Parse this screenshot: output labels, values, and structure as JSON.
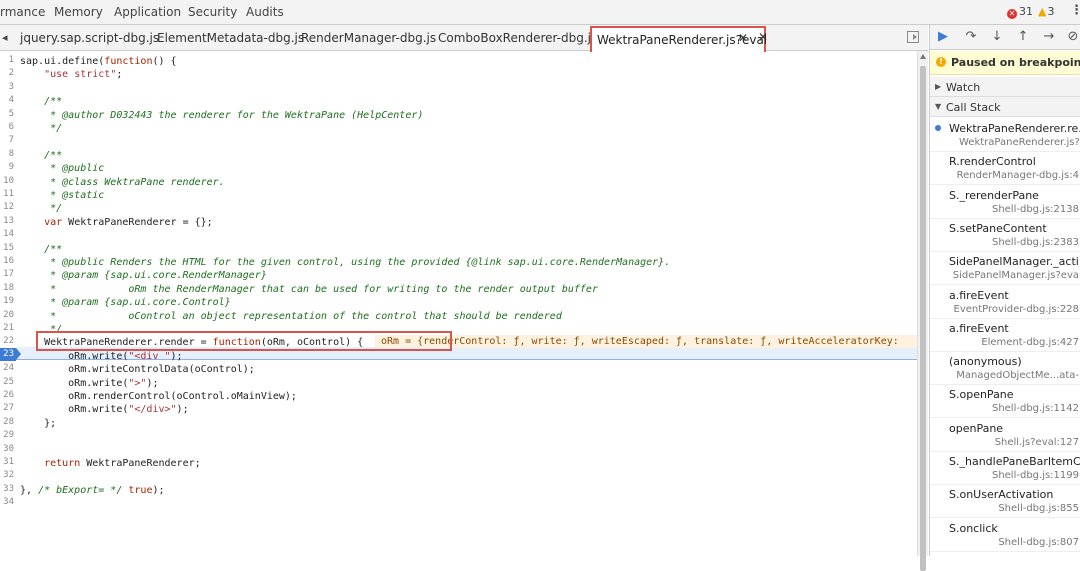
{
  "top_tabs": [
    "rmance",
    "Memory",
    "Application",
    "Security",
    "Audits"
  ],
  "errors": {
    "error_count": "31",
    "warning_count": "3"
  },
  "file_tabs": [
    "jquery.sap.script-dbg.js",
    "ElementMetadata-dbg.js",
    "RenderManager-dbg.js",
    "ComboBoxRenderer-dbg.js",
    "WektraPaneRenderer.js?eval"
  ],
  "active_tab": "WektraPaneRenderer.js?eval",
  "code_lines": [
    "sap.ui.define(function() {",
    "    \"use strict\";",
    "",
    "    /**",
    "     * @author D032443 the renderer for the WektraPane (HelpCenter)",
    "     */",
    "",
    "    /**",
    "     * @public",
    "     * @class WektraPane renderer.",
    "     * @static",
    "     */",
    "    var WektraPaneRenderer = {};",
    "",
    "    /**",
    "     * @public Renders the HTML for the given control, using the provided {@link sap.ui.core.RenderManager}.",
    "     * @param {sap.ui.core.RenderManager}",
    "     *            oRm the RenderManager that can be used for writing to the render output buffer",
    "     * @param {sap.ui.core.Control}",
    "     *            oControl an object representation of the control that should be rendered",
    "     */",
    "    WektraPaneRenderer.render = function(oRm, oControl) {",
    "        oRm.write(\"<div \");",
    "        oRm.writeControlData(oControl);",
    "        oRm.write(\">\");",
    "        oRm.renderControl(oControl.oMainView);",
    "        oRm.write(\"</div>\");",
    "    };",
    "",
    "",
    "    return WektraPaneRenderer;",
    "",
    "}, /* bExport= */ true);",
    ""
  ],
  "inline_value": "oRm = {renderControl: ƒ, write: ƒ, writeEscaped: ƒ, translate: ƒ, writeAcceleratorKey:",
  "breakpoint_line": "23",
  "debugger": {
    "paused_text": "Paused on breakpoint",
    "watch_label": "Watch",
    "callstack_label": "Call Stack",
    "frames": [
      {
        "fn": "WektraPaneRenderer.re...",
        "loc": "WektraPaneRenderer.js?e"
      },
      {
        "fn": "R.renderControl",
        "loc": "RenderManager-dbg.js:4"
      },
      {
        "fn": "S._rerenderPane",
        "loc": "Shell-dbg.js:2138"
      },
      {
        "fn": "S.setPaneContent",
        "loc": "Shell-dbg.js:2383"
      },
      {
        "fn": "SidePanelManager._acti...",
        "loc": "SidePanelManager.js?eva"
      },
      {
        "fn": "a.fireEvent",
        "loc": "EventProvider-dbg.js:228"
      },
      {
        "fn": "a.fireEvent",
        "loc": "Element-dbg.js:427"
      },
      {
        "fn": "(anonymous)",
        "loc": "ManagedObjectMe...ata-"
      },
      {
        "fn": "S.openPane",
        "loc": "Shell-dbg.js:1142"
      },
      {
        "fn": "openPane",
        "loc": "Shell.js?eval:127"
      },
      {
        "fn": "S._handlePaneBarItemC...",
        "loc": "Shell-dbg.js:1199"
      },
      {
        "fn": "S.onUserActivation",
        "loc": "Shell-dbg.js:855"
      },
      {
        "fn": "S.onclick",
        "loc": "Shell-dbg.js:807"
      }
    ]
  },
  "icons": {
    "error": "error-icon",
    "warning": "warning-icon",
    "more": "more-vert-icon"
  }
}
